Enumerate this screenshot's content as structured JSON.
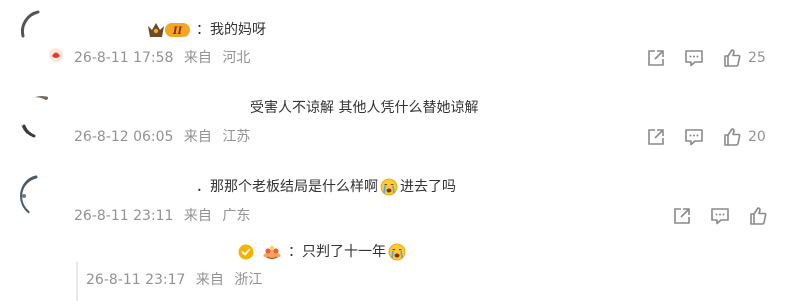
{
  "comments": [
    {
      "text_prefix": "：",
      "text": "我的妈呀",
      "date": "26-8-11 17:58",
      "source_prefix": "来自",
      "location": "河北",
      "like_count": "25",
      "badge_level": "II"
    },
    {
      "text": "受害人不谅解 其他人凭什么替她谅解",
      "date": "26-8-12 06:05",
      "source_prefix": "来自",
      "location": "江苏",
      "like_count": "20"
    },
    {
      "text_prefix": "．",
      "text_a": "那那个老板结局是什么样啊",
      "text_b": "进去了吗",
      "date": "26-8-11 23:11",
      "source_prefix": "来自",
      "location": "广东"
    }
  ],
  "reply": {
    "text_prefix": "：",
    "text": "只判了十一年",
    "date": "26-8-11 23:17",
    "source_prefix": "来自",
    "location": "浙江"
  },
  "icons": {
    "share": "share-icon",
    "comment": "comment-icon",
    "like": "thumbs-up-icon",
    "crying_emoji": "crying-face-emoji",
    "verified": "verified-badge-icon",
    "level_badge": "crown-level-badge"
  },
  "colors": {
    "meta_gray": "#939393",
    "icon_gray": "#8a8a8a",
    "badge_gold": "#f5a623",
    "badge_brown": "#6b4a2b",
    "verified_yellow": "#f6b200"
  }
}
